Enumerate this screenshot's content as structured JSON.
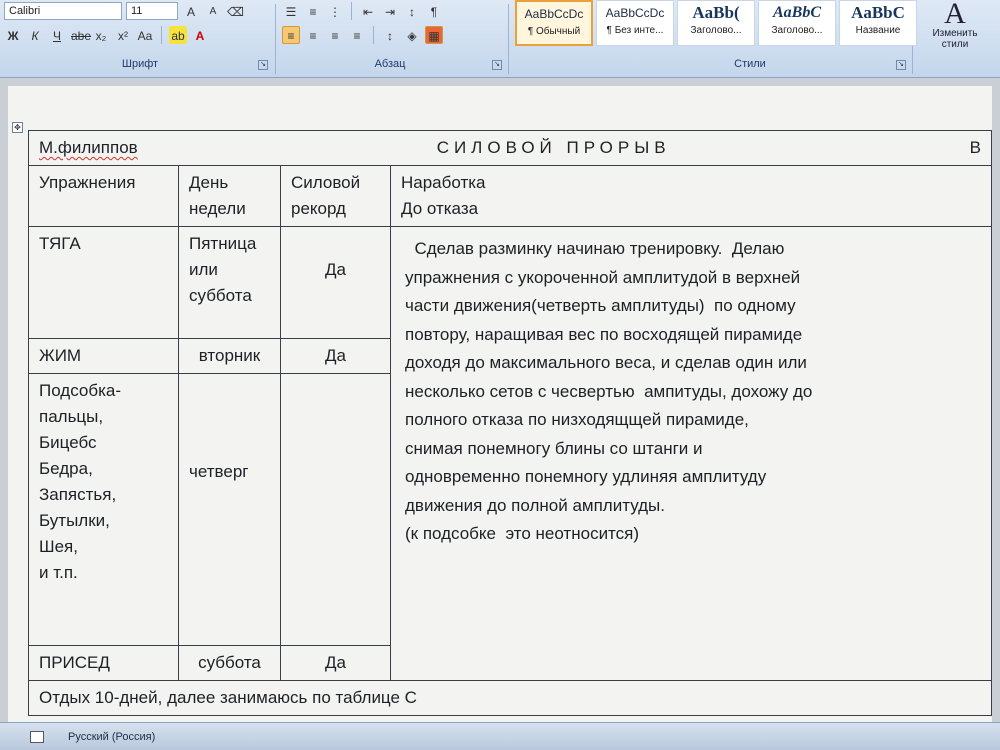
{
  "ribbon": {
    "font_name": "Calibri",
    "font_size": "11",
    "font_group_label": "Шрифт",
    "paragraph_group_label": "Абзац",
    "styles_group_label": "Стили",
    "styles": [
      {
        "sample": "AaBbCcDc",
        "name": "¶ Обычный",
        "selected": true,
        "kind": "normal"
      },
      {
        "sample": "AaBbCcDc",
        "name": "¶ Без инте...",
        "selected": false,
        "kind": "normal"
      },
      {
        "sample": "AaBb(",
        "name": "Заголово...",
        "selected": false,
        "kind": "big"
      },
      {
        "sample": "AaBbC",
        "name": "Заголово...",
        "selected": false,
        "kind": "ital"
      },
      {
        "sample": "AaBbC",
        "name": "Название",
        "selected": false,
        "kind": "big"
      }
    ],
    "change_styles_glyph": "A",
    "change_styles_label": "Изменить стили"
  },
  "document": {
    "table": {
      "author": "М.филиппов",
      "title": "СИЛОВОЙ ПРОРЫВ",
      "corner": "В",
      "col_headers": {
        "exercise": "Упражнения",
        "day_line1": "День",
        "day_line2": "недели",
        "record_line1": "Силовой",
        "record_line2": "рекорд",
        "work_line1": "Наработка",
        "work_line2": "До отказа"
      },
      "rows": [
        {
          "exercise": "ТЯГА",
          "day_lines": [
            "Пятница",
            "или",
            "суббота"
          ],
          "record": "Да"
        },
        {
          "exercise": "ЖИМ",
          "day": "вторник",
          "record": "Да"
        },
        {
          "exercise_lines": [
            "Подсобка-",
            "пальцы,",
            "Бицебс",
            "Бедра,",
            "Запястья,",
            "Бутылки,",
            "Шея,",
            "и т.п."
          ],
          "day": "четверг",
          "record": ""
        },
        {
          "exercise": "ПРИСЕД",
          "day": "суббота",
          "record": "Да"
        }
      ],
      "description_lines": [
        "  Сделав разминку начинаю тренировку.  Делаю",
        "упражнения с укороченной амплитудой в верхней",
        "части движения(четверть амплитуды)  по одному",
        "повтору, наращивая вес по восходящей пирамиде",
        "доходя до максимального веса, и сделав один или",
        "несколько сетов с чесвертью  ампитуды, дохожу до",
        "полного отказа по низходящщей пирамиде,",
        "снимая понемногу блины со штанги и",
        "одновременно понемногу удлиняя амплитуду",
        "движения до полной амплитуды.",
        "(к подсобке  это неотносится)"
      ],
      "footer": "Отдых 10-дней, далее занимаюсь по таблице С"
    }
  },
  "statusbar": {
    "language": "Русский (Россия)"
  }
}
